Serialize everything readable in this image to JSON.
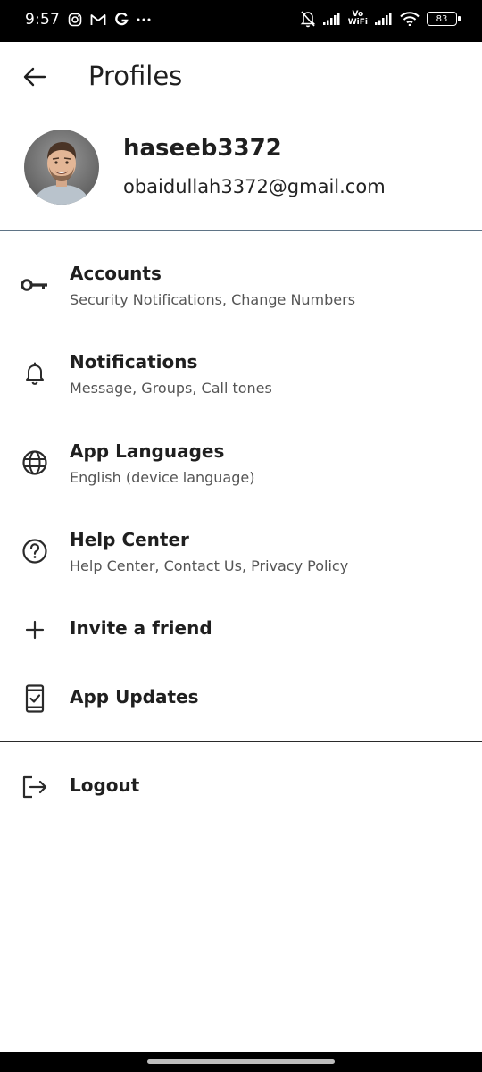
{
  "status_bar": {
    "time": "9:57",
    "left_icons": [
      "instagram-icon",
      "gmail-icon",
      "google-icon",
      "more-dots-icon"
    ],
    "vo_top": "Vo",
    "vo_bottom": "WiFi",
    "battery": "83"
  },
  "app_bar": {
    "title": "Profiles"
  },
  "profile": {
    "username": "haseeb3372",
    "email": "obaidullah3372@gmail.com"
  },
  "menu": {
    "accounts": {
      "title": "Accounts",
      "subtitle": "Security Notifications, Change Numbers",
      "icon": "key-icon"
    },
    "notifications": {
      "title": "Notifications",
      "subtitle": "Message, Groups, Call tones",
      "icon": "bell-icon"
    },
    "languages": {
      "title": "App Languages",
      "subtitle": "English (device language)",
      "icon": "globe-icon"
    },
    "help": {
      "title": "Help Center",
      "subtitle": "Help Center, Contact Us, Privacy Policy",
      "icon": "help-circle-icon"
    },
    "invite": {
      "title": "Invite a friend",
      "icon": "plus-icon"
    },
    "updates": {
      "title": "App Updates",
      "icon": "phone-check-icon"
    },
    "logout": {
      "title": "Logout",
      "icon": "logout-icon"
    }
  },
  "colors": {
    "status_bar": "#000000",
    "background": "#ffffff",
    "text_primary": "#1f1f1f",
    "text_secondary": "#555555",
    "divider": "#5f7486"
  }
}
